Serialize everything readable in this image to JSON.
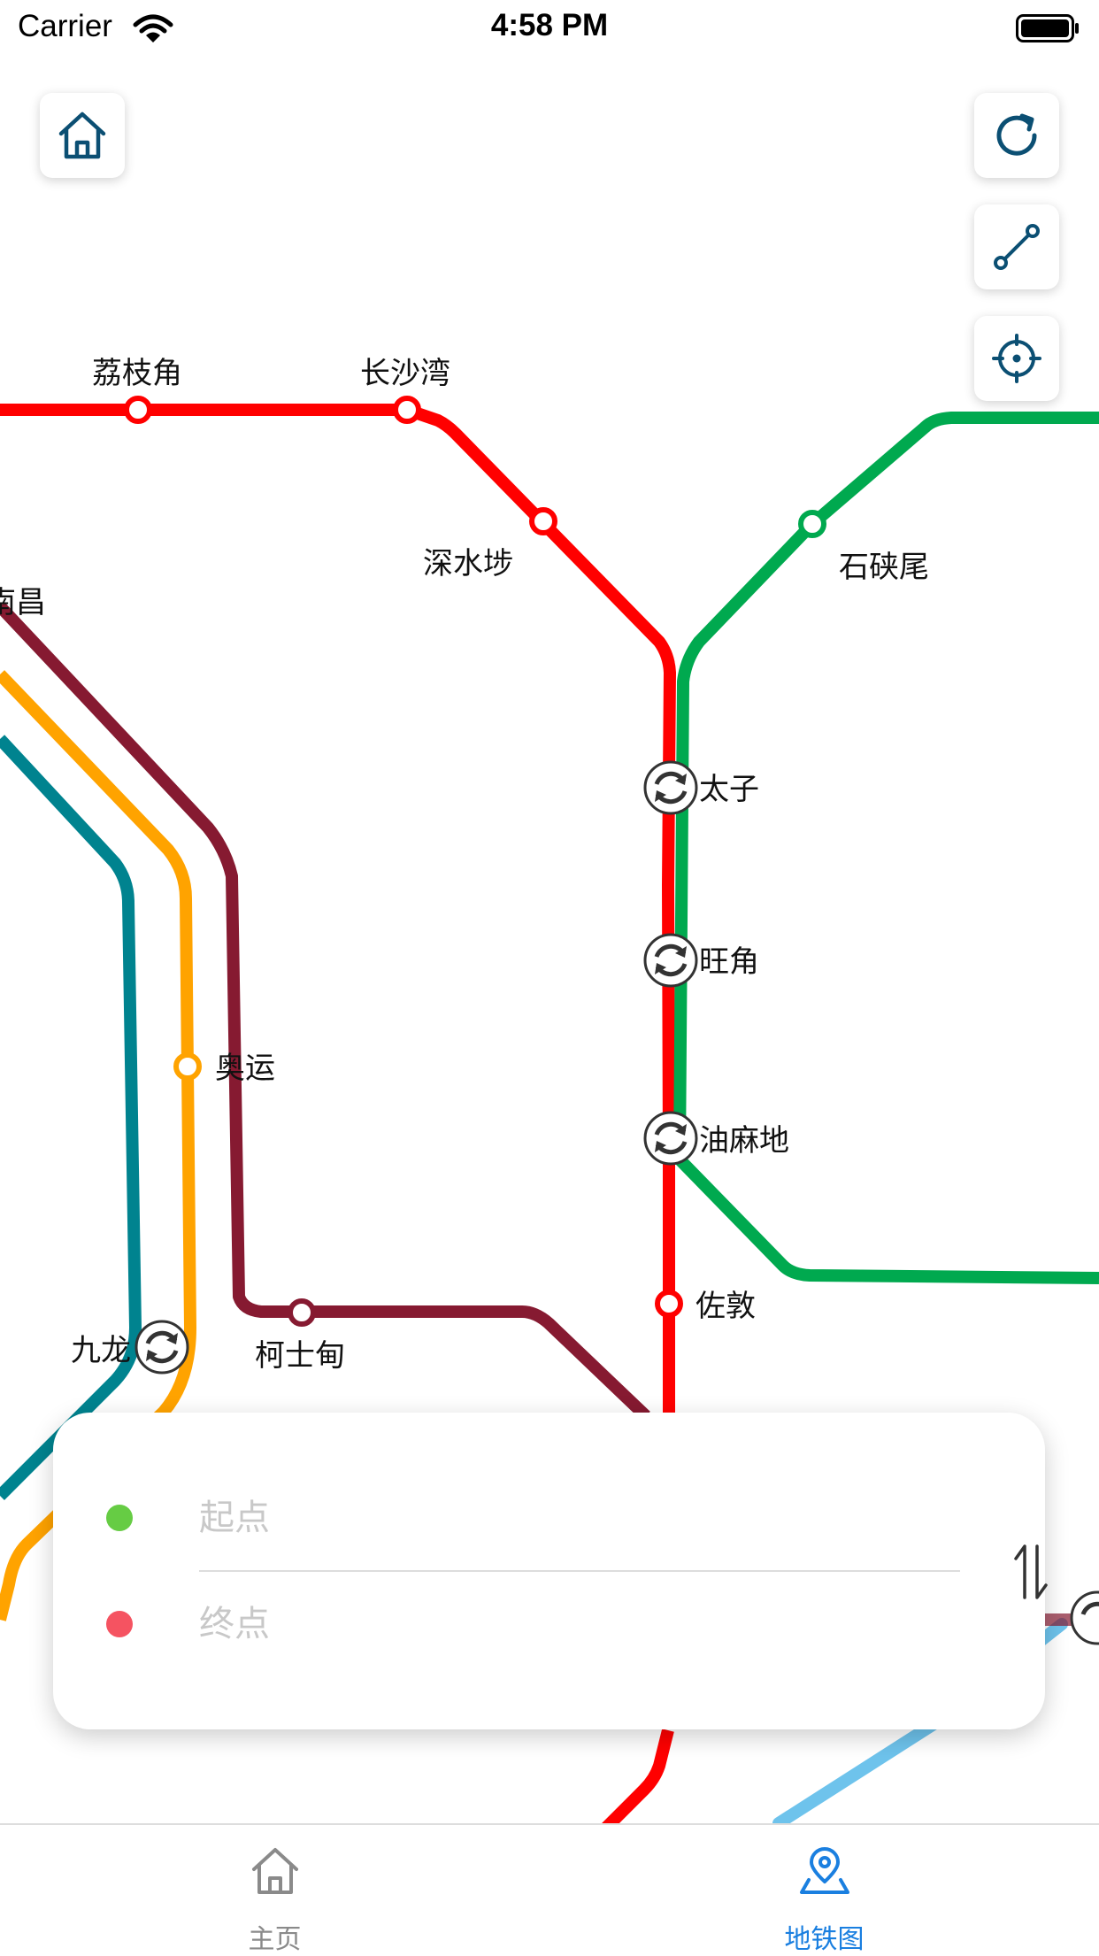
{
  "status_bar": {
    "carrier": "Carrier",
    "time": "4:58 PM"
  },
  "controls": {
    "home_icon": "house-icon",
    "refresh_icon": "refresh-icon",
    "route_icon": "route-icon",
    "locate_icon": "crosshair-icon"
  },
  "colors": {
    "red_line": "#ff0000",
    "green_line": "#00a94f",
    "maroon_line": "#861a31",
    "orange_line": "#ffa300",
    "teal_line": "#00838f",
    "light_blue_line": "#6ec3ec",
    "accent": "#1a7fe0",
    "start_dot": "#66cc44",
    "end_dot": "#f55361",
    "icon_navy": "#0b4f73"
  },
  "stations": {
    "lai_chi_kok": "荔枝角",
    "cheung_sha_wan": "长沙湾",
    "sham_shui_po": "深水埗",
    "shek_kip_mei": "石硖尾",
    "nam_cheong": "南昌",
    "prince_edward": "太子",
    "mong_kok": "旺角",
    "olympic": "奥运",
    "yau_ma_tei": "油麻地",
    "jordan": "佐敦",
    "kowloon": "九龙",
    "austin": "柯士甸"
  },
  "route_card": {
    "start_placeholder": "起点",
    "end_placeholder": "终点",
    "swap_icon": "swap-vertical-icon"
  },
  "tabbar": {
    "tabs": [
      {
        "label": "主页",
        "icon": "house-icon",
        "active": false
      },
      {
        "label": "地铁图",
        "icon": "map-pin-icon",
        "active": true
      }
    ]
  }
}
